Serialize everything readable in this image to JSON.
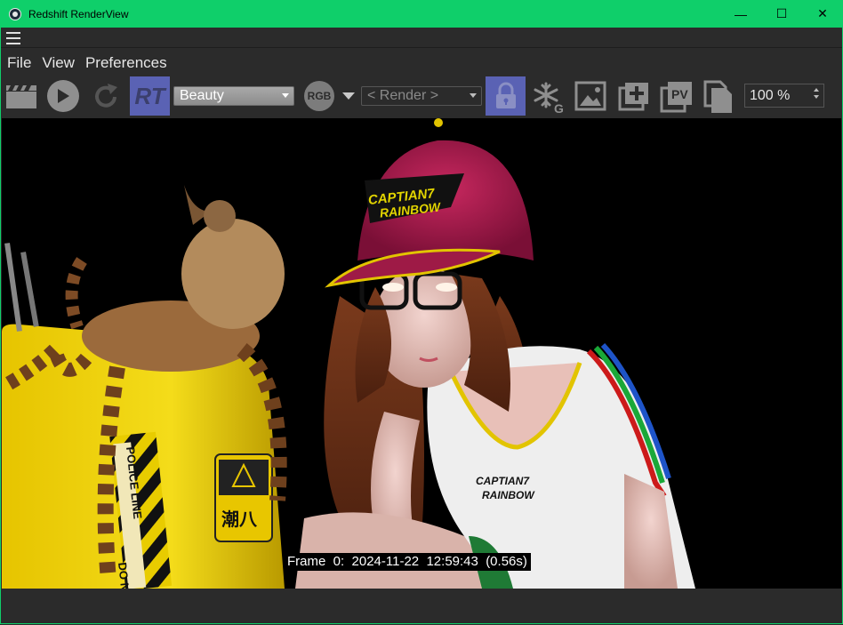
{
  "window": {
    "title": "Redshift RenderView",
    "minimize": "—",
    "maximize": "☐",
    "close": "✕"
  },
  "menu": {
    "items": [
      "File",
      "View",
      "Preferences"
    ]
  },
  "toolbar": {
    "rt_label": "RT",
    "aov_selected": "Beauty",
    "rgb_label": "RGB",
    "snapshot_selected": "< Render >",
    "zoom_value": "100 %",
    "pv_label": "PV",
    "freeze_badge": "G",
    "icons": [
      "clapperboard-icon",
      "play-icon",
      "refresh-icon",
      "rt-icon",
      "lock-icon",
      "freeze-icon",
      "image-icon",
      "add-image-icon",
      "pv-icon",
      "copy-icon"
    ]
  },
  "render": {
    "frame_info": "Frame  0:  2024-11-22  12:59:43  (0.56s)",
    "cap_text_1": "CAPTIAN7",
    "cap_text_2": "RAINBOW",
    "shirt_text_1": "CAPTIAN7",
    "shirt_text_2": "RAINBOW",
    "tape_text_1": "POLICE LINE",
    "tape_text_2": "DO N",
    "sign_text": "潮八"
  },
  "colors": {
    "titlebar": "#0fcf6a",
    "accent_button": "#5a62b4",
    "background": "#2b2b2b"
  }
}
